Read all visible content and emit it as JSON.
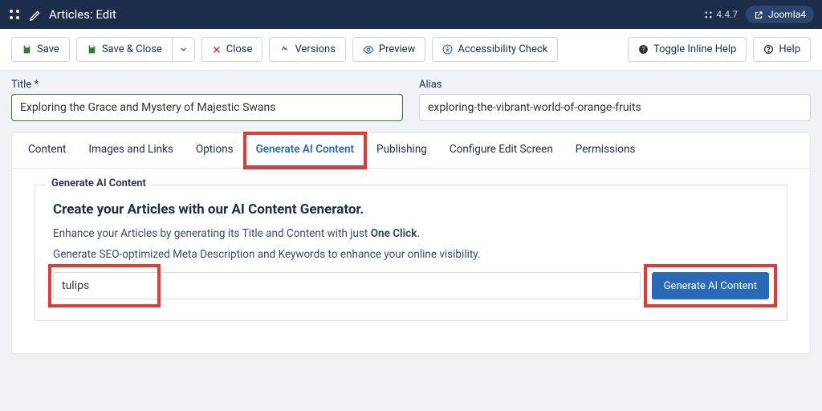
{
  "topbar": {
    "title": "Articles: Edit",
    "version": "4.4.7",
    "site_name": "Joomla4"
  },
  "toolbar": {
    "save": "Save",
    "save_close": "Save & Close",
    "close": "Close",
    "versions": "Versions",
    "preview": "Preview",
    "a11y": "Accessibility Check",
    "inline_help": "Toggle Inline Help",
    "help": "Help"
  },
  "form": {
    "title_label": "Title *",
    "title_value": "Exploring the Grace and Mystery of Majestic Swans",
    "alias_label": "Alias",
    "alias_value": "exploring-the-vibrant-world-of-orange-fruits"
  },
  "tabs": [
    {
      "label": "Content"
    },
    {
      "label": "Images and Links"
    },
    {
      "label": "Options"
    },
    {
      "label": "Generate AI Content"
    },
    {
      "label": "Publishing"
    },
    {
      "label": "Configure Edit Screen"
    },
    {
      "label": "Permissions"
    }
  ],
  "panel": {
    "legend": "Generate AI Content",
    "heading": "Create your Articles with our AI Content Generator.",
    "line1_a": "Enhance your Articles by generating its Title and Content with just ",
    "line1_b": "One Click",
    "line1_c": ".",
    "line2": "Generate SEO-optimized Meta Description and Keywords to enhance your online visibility.",
    "input_value": "tulips",
    "button": "Generate AI Content"
  }
}
